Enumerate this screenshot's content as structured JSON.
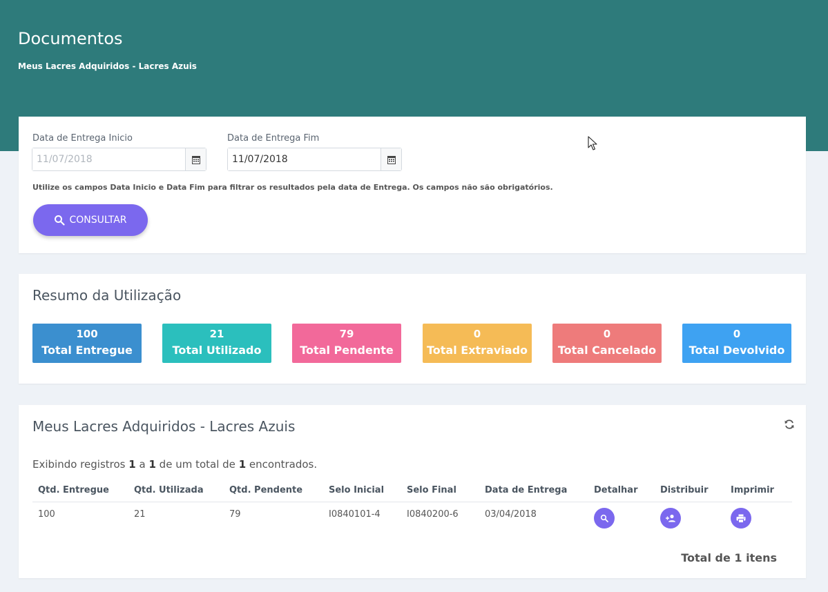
{
  "header": {
    "title": "Documentos",
    "subtitle": "Meus Lacres Adquiridos - Lacres Azuis"
  },
  "filter": {
    "start_label": "Data de Entrega Inicio",
    "start_placeholder": "11/07/2018",
    "end_label": "Data de Entrega Fim",
    "end_value": "11/07/2018",
    "help": "Utilize os campos Data Inicio e Data Fim para filtrar os resultados pela data de Entrega. Os campos não são obrigatórios.",
    "button_label": "CONSULTAR"
  },
  "summary": {
    "title": "Resumo da Utilização",
    "stats": [
      {
        "value": "100",
        "label": "Total Entregue",
        "color": "#3b8fcf"
      },
      {
        "value": "21",
        "label": "Total Utilizado",
        "color": "#2bbfbd"
      },
      {
        "value": "79",
        "label": "Total Pendente",
        "color": "#f2699a"
      },
      {
        "value": "0",
        "label": "Total Extraviado",
        "color": "#f5bb56"
      },
      {
        "value": "0",
        "label": "Total Cancelado",
        "color": "#ee7b7b"
      },
      {
        "value": "0",
        "label": "Total Devolvido",
        "color": "#3ea2f2"
      }
    ]
  },
  "table": {
    "title": "Meus Lacres Adquiridos - Lacres Azuis",
    "records_prefix": "Exibindo registros",
    "records_from": "1",
    "records_a": "a",
    "records_to": "1",
    "records_mid": "de um total de",
    "records_total": "1",
    "records_suffix": "encontrados.",
    "columns": [
      "Qtd. Entregue",
      "Qtd. Utilizada",
      "Qtd. Pendente",
      "Selo Inicial",
      "Selo Final",
      "Data de Entrega",
      "Detalhar",
      "Distribuir",
      "Imprimir"
    ],
    "rows": [
      [
        "100",
        "21",
        "79",
        "I0840101-4",
        "I0840200-6",
        "03/04/2018"
      ]
    ],
    "total_label": "Total de 1 itens"
  },
  "colors": {
    "header_bg": "#2e7b7b",
    "accent": "#7b68ee"
  }
}
